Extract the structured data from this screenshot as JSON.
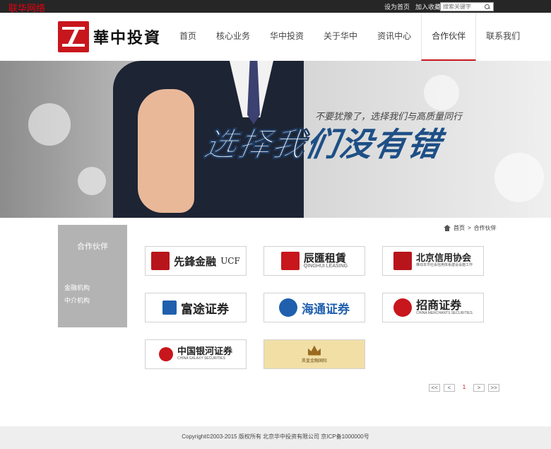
{
  "topbar": {
    "net_label": "联华网络",
    "links": [
      "设为首页",
      "加入收藏"
    ],
    "search_placeholder": "搜索关键字"
  },
  "logo": {
    "text": "華中投資"
  },
  "nav": [
    "首页",
    "核心业务",
    "华中投资",
    "关于华中",
    "资讯中心",
    "合作伙伴",
    "联系我们"
  ],
  "nav_active_index": 5,
  "banner": {
    "subtitle": "不要犹豫了，选择我们与高质量同行",
    "slogan_a": "选择我",
    "slogan_b": "们没有错"
  },
  "sidebar": {
    "title": "合作伙伴",
    "items": [
      "金融机构",
      "中介机构"
    ]
  },
  "breadcrumb": {
    "home": "首页",
    "sep": ">",
    "current": "合作伙伴"
  },
  "partners": [
    {
      "name": "先鋒金融",
      "extra": "UCF",
      "color": "#b8141b",
      "icon": "xianfeng-seal-icon"
    },
    {
      "name": "辰匯租賃",
      "extra": "QINGHUI LEASING",
      "color": "#c8161d",
      "icon": "qinghui-logo-icon"
    },
    {
      "name": "北京信用协会",
      "extra": "推动本市社会信用体系建设设施工作",
      "color": "#b8141b",
      "icon": "credit-association-icon"
    },
    {
      "name": "富途证券",
      "extra": "",
      "color": "#1f5fae",
      "icon": "futu-logo-icon"
    },
    {
      "name": "海通证券",
      "extra": "",
      "color": "#1f5fae",
      "icon": "haitong-logo-icon"
    },
    {
      "name": "招商证券",
      "extra": "CHINA MERCHANTS SECURITIES",
      "color": "#c8161d",
      "icon": "merchants-logo-icon"
    },
    {
      "name": "中国银河证券",
      "extra": "CHINA GALAXY SECURITIES",
      "color": "#c8161d",
      "icon": "galaxy-logo-icon"
    },
    {
      "name": "",
      "extra": "英皇金融国际",
      "color": "#9a6b1f",
      "icon": "crown-icon"
    }
  ],
  "pager": [
    "<<",
    "<",
    "1",
    ">",
    ">>"
  ],
  "pager_current_index": 2,
  "footer": {
    "text": "Copyright©2003-2015 版权所有 北京华中投资有限公司 京ICP备1000000号"
  }
}
